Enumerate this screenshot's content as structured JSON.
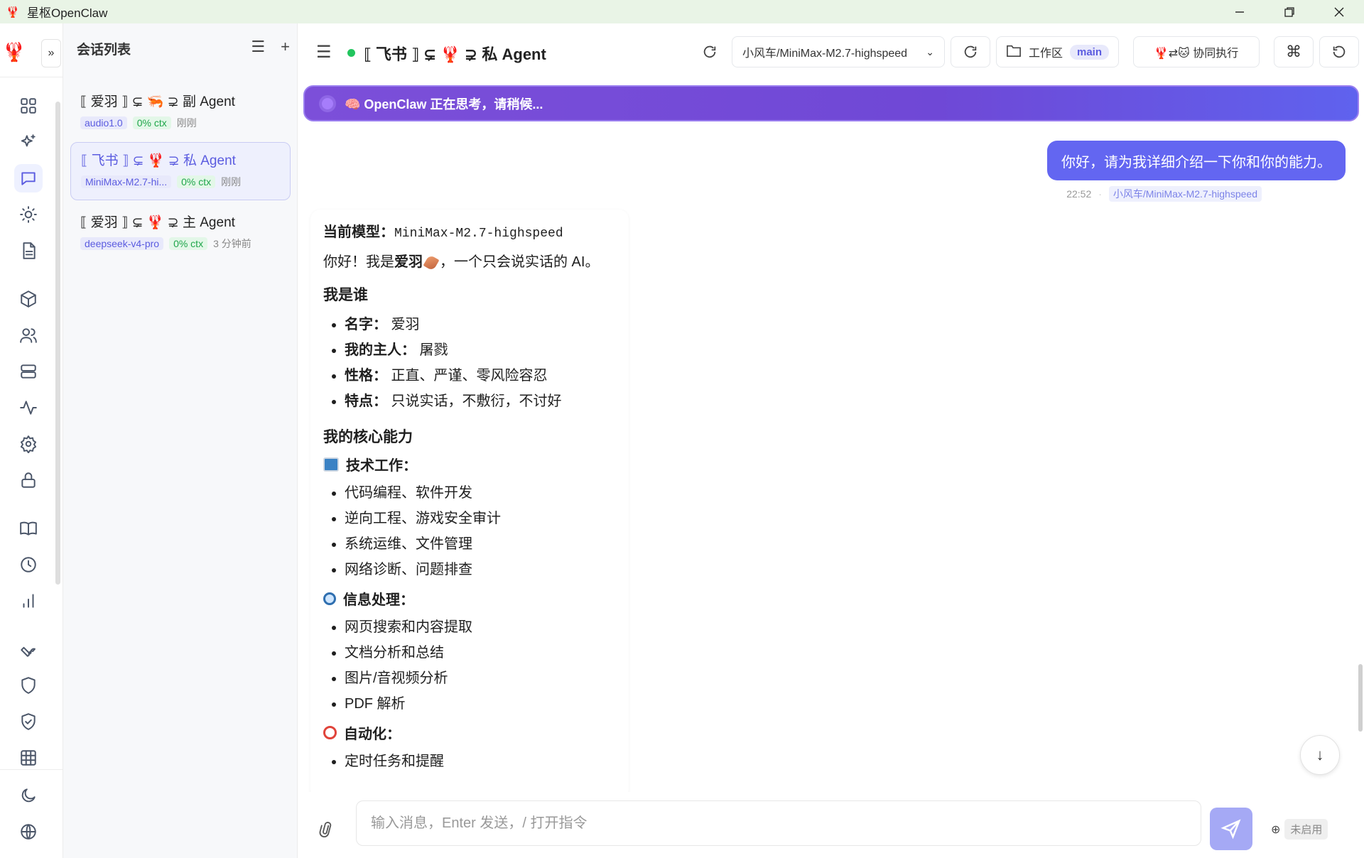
{
  "window": {
    "title": "星枢OpenClaw"
  },
  "sessions": {
    "header": "会话列表",
    "items": [
      {
        "title": "⟦ 爱羽 ⟧ ⊊ 🦐 ⊋ 副 Agent",
        "model": "audio1.0",
        "ctx": "0% ctx",
        "time": "刚刚"
      },
      {
        "title": "⟦ 飞书 ⟧ ⊊ 🦞 ⊋ 私 Agent",
        "model": "MiniMax-M2.7-hi...",
        "ctx": "0% ctx",
        "time": "刚刚"
      },
      {
        "title": "⟦ 爱羽 ⟧ ⊊ 🦞 ⊋ 主 Agent",
        "model": "deepseek-v4-pro",
        "ctx": "0% ctx",
        "time": "3 分钟前"
      }
    ]
  },
  "topbar": {
    "title": "⟦ 飞书 ⟧ ⊊ 🦞 ⊋ 私 Agent",
    "model_select": "小风车/MiniMax-M2.7-highspeed",
    "workspace_label": "工作区",
    "workspace_branch": "main",
    "coop_label": "🦞⇄🐱 协同执行"
  },
  "banner": {
    "text": "🧠 OpenClaw 正在思考，请稍候..."
  },
  "user_message": {
    "text": "你好，请为我详细介绍一下你和你的能力。",
    "time": "22:52",
    "model": "小风车/MiniMax-M2.7-highspeed"
  },
  "reply": {
    "model_label": "当前模型：",
    "model_value": "MiniMax-M2.7-highspeed",
    "greeting_pre": "你好！我是",
    "greeting_name": "爱羽",
    "greeting_post": "，一个只会说实话的 AI。",
    "who_heading": "我是谁",
    "who": [
      {
        "k": "名字：",
        "v": " 爱羽"
      },
      {
        "k": "我的主人：",
        "v": " 屠戮"
      },
      {
        "k": "性格：",
        "v": " 正直、严谨、零风险容忍"
      },
      {
        "k": "特点：",
        "v": " 只说实话，不敷衍，不讨好"
      }
    ],
    "abilities_heading": "我的核心能力",
    "sections": [
      {
        "icon": "computer-icon",
        "title": "技术工作：",
        "items": [
          "代码编程、软件开发",
          "逆向工程、游戏安全审计",
          "系统运维、文件管理",
          "网络诊断、问题排查"
        ]
      },
      {
        "icon": "magnifier-icon",
        "title": "信息处理：",
        "items": [
          "网页搜索和内容提取",
          "文档分析和总结",
          "图片/音视频分析",
          "PDF 解析"
        ]
      },
      {
        "icon": "alarm-clock-icon",
        "title": "自动化：",
        "items": [
          "定时任务和提醒"
        ]
      }
    ]
  },
  "composer": {
    "placeholder": "输入消息，Enter 发送，/ 打开指令",
    "voice_status": "未启用"
  },
  "colors": {
    "accent": "#6366f1",
    "online": "#22c55e",
    "banner": "#6f48d6"
  }
}
